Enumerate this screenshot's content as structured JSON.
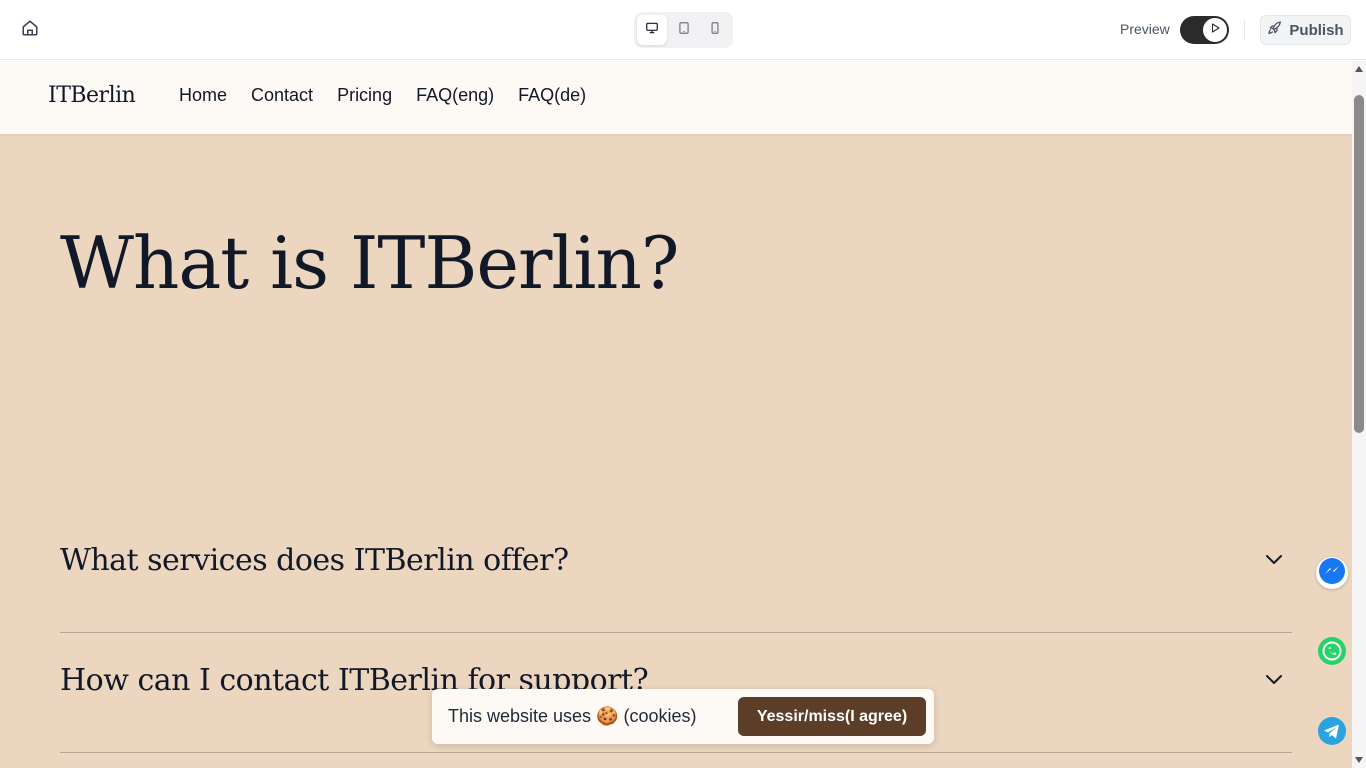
{
  "editor": {
    "preview_label": "Preview",
    "publish_label": "Publish",
    "icons": {
      "home": "home-icon",
      "desktop": "desktop-icon",
      "tablet": "tablet-icon",
      "mobile": "mobile-icon",
      "play": "play-icon",
      "rocket": "rocket-icon"
    },
    "active_device": "desktop"
  },
  "site": {
    "logo": "ITBerlin",
    "nav": [
      "Home",
      "Contact",
      "Pricing",
      "FAQ(eng)",
      "FAQ(de)"
    ],
    "hero_title": "What is ITBerlin?",
    "faq": [
      "What services does ITBerlin offer?",
      "How can I contact ITBerlin for support?"
    ],
    "background_color": "#ecd6c0"
  },
  "cookie_banner": {
    "text": "This website uses 🍪 (cookies)",
    "button": "Yessir/miss(I agree)"
  },
  "chat_widgets": [
    "messenger-icon",
    "whatsapp-icon",
    "telegram-icon"
  ]
}
